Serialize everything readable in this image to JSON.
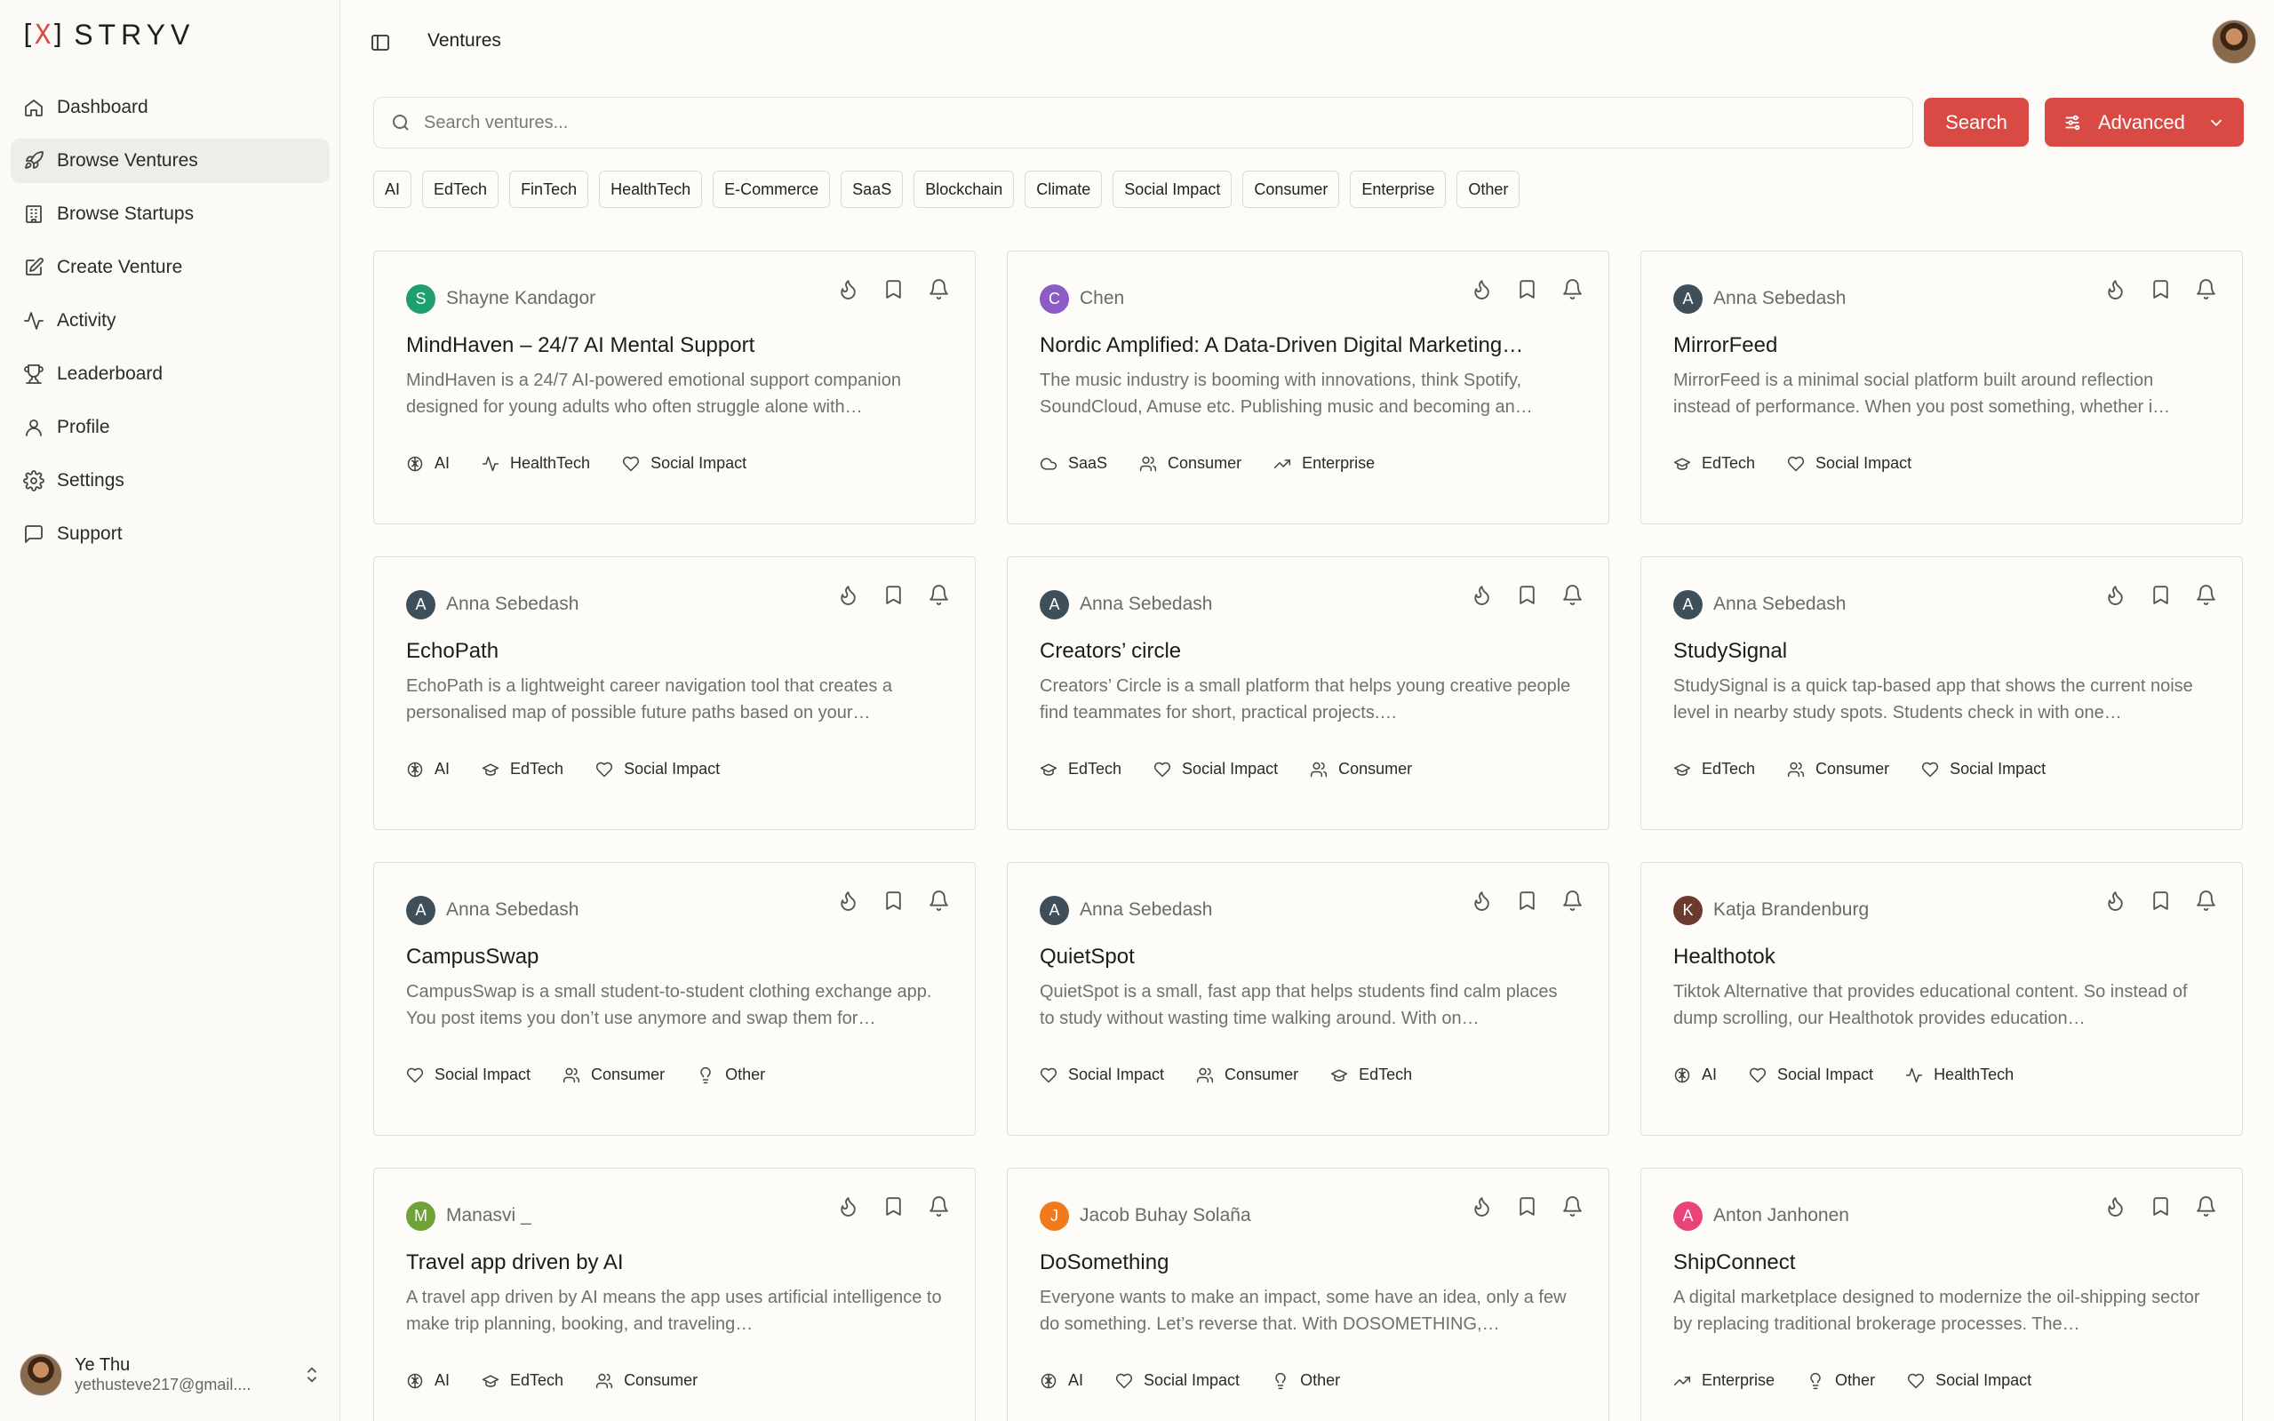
{
  "brand": {
    "name": "STRYV",
    "accent": "#d94a44"
  },
  "sidebar": {
    "items": [
      {
        "label": "Dashboard",
        "icon": "home-icon",
        "active": false
      },
      {
        "label": "Browse Ventures",
        "icon": "rocket-icon",
        "active": true
      },
      {
        "label": "Browse Startups",
        "icon": "building-icon",
        "active": false
      },
      {
        "label": "Create Venture",
        "icon": "edit-icon",
        "active": false
      },
      {
        "label": "Activity",
        "icon": "activity-icon",
        "active": false
      },
      {
        "label": "Leaderboard",
        "icon": "trophy-icon",
        "active": false
      },
      {
        "label": "Profile",
        "icon": "user-icon",
        "active": false
      },
      {
        "label": "Settings",
        "icon": "gear-icon",
        "active": false
      },
      {
        "label": "Support",
        "icon": "message-icon",
        "active": false
      }
    ],
    "user": {
      "name": "Ye Thu",
      "email": "yethusteve217@gmail...."
    }
  },
  "header": {
    "breadcrumb": "Ventures"
  },
  "search": {
    "placeholder": "Search ventures...",
    "button_label": "Search",
    "advanced_label": "Advanced"
  },
  "filters": [
    "AI",
    "EdTech",
    "FinTech",
    "HealthTech",
    "E-Commerce",
    "SaaS",
    "Blockchain",
    "Climate",
    "Social Impact",
    "Consumer",
    "Enterprise",
    "Other"
  ],
  "ventures": [
    {
      "initial": "S",
      "color": "#1f9e6e",
      "author": "Shayne Kandagor",
      "title": "MindHaven – 24/7 AI Mental Support",
      "desc": "MindHaven is a 24/7 AI-powered emotional support companion designed for young adults who often struggle alone with…",
      "tags": [
        [
          "AI",
          "brain-icon"
        ],
        [
          "HealthTech",
          "activity-icon"
        ],
        [
          "Social Impact",
          "heart-icon"
        ]
      ]
    },
    {
      "initial": "C",
      "color": "#8b5cc4",
      "author": "Chen",
      "title": "Nordic Amplified: A Data-Driven Digital Marketing…",
      "desc": "The music industry is booming with innovations, think Spotify, SoundCloud, Amuse etc. Publishing music and becoming an…",
      "tags": [
        [
          "SaaS",
          "cloud-icon"
        ],
        [
          "Consumer",
          "users-icon"
        ],
        [
          "Enterprise",
          "trending-up-icon"
        ]
      ]
    },
    {
      "initial": "A",
      "color": "#3f4f5a",
      "author": "Anna Sebedash",
      "title": "MirrorFeed",
      "desc": "MirrorFeed is a minimal social platform built around reflection instead of performance. When you post something, whether i…",
      "tags": [
        [
          "EdTech",
          "graduation-cap-icon"
        ],
        [
          "Social Impact",
          "heart-icon"
        ]
      ]
    },
    {
      "initial": "A",
      "color": "#3f4f5a",
      "author": "Anna Sebedash",
      "title": "EchoPath",
      "desc": "EchoPath is a lightweight career navigation tool that creates a personalised map of possible future paths based on your…",
      "tags": [
        [
          "AI",
          "brain-icon"
        ],
        [
          "EdTech",
          "graduation-cap-icon"
        ],
        [
          "Social Impact",
          "heart-icon"
        ]
      ]
    },
    {
      "initial": "A",
      "color": "#3f4f5a",
      "author": "Anna Sebedash",
      "title": "Creators’ circle",
      "desc": "Creators’ Circle is a small platform that helps young creative people find teammates for short, practical projects.…",
      "tags": [
        [
          "EdTech",
          "graduation-cap-icon"
        ],
        [
          "Social Impact",
          "heart-icon"
        ],
        [
          "Consumer",
          "users-icon"
        ]
      ]
    },
    {
      "initial": "A",
      "color": "#3f4f5a",
      "author": "Anna Sebedash",
      "title": "StudySignal",
      "desc": "StudySignal is a quick tap-based app that shows the current noise level in nearby study spots. Students check in with one…",
      "tags": [
        [
          "EdTech",
          "graduation-cap-icon"
        ],
        [
          "Consumer",
          "users-icon"
        ],
        [
          "Social Impact",
          "heart-icon"
        ]
      ]
    },
    {
      "initial": "A",
      "color": "#3f4f5a",
      "author": "Anna Sebedash",
      "title": "CampusSwap",
      "desc": "CampusSwap is a small student-to-student clothing exchange app. You post items you don’t use anymore and swap them for…",
      "tags": [
        [
          "Social Impact",
          "heart-icon"
        ],
        [
          "Consumer",
          "users-icon"
        ],
        [
          "Other",
          "lightbulb-icon"
        ]
      ]
    },
    {
      "initial": "A",
      "color": "#3f4f5a",
      "author": "Anna Sebedash",
      "title": "QuietSpot",
      "desc": "QuietSpot is a small, fast app that helps students find calm places to study without wasting time walking around. With on…",
      "tags": [
        [
          "Social Impact",
          "heart-icon"
        ],
        [
          "Consumer",
          "users-icon"
        ],
        [
          "EdTech",
          "graduation-cap-icon"
        ]
      ]
    },
    {
      "initial": "K",
      "color": "#6b3a2e",
      "author": "Katja Brandenburg",
      "title": "Healthotok",
      "desc": "Tiktok Alternative that provides educational content. So instead of dump scrolling, our Healthotok provides education…",
      "tags": [
        [
          "AI",
          "brain-icon"
        ],
        [
          "Social Impact",
          "heart-icon"
        ],
        [
          "HealthTech",
          "activity-icon"
        ]
      ]
    },
    {
      "initial": "M",
      "color": "#6fa33a",
      "author": "Manasvi _",
      "title": "Travel app driven by AI",
      "desc": "A travel app driven by AI means the app uses artificial intelligence to make trip planning, booking, and traveling…",
      "tags": [
        [
          "AI",
          "brain-icon"
        ],
        [
          "EdTech",
          "graduation-cap-icon"
        ],
        [
          "Consumer",
          "users-icon"
        ]
      ]
    },
    {
      "initial": "J",
      "color": "#f07a1c",
      "author": "Jacob Buhay Solaña",
      "title": "DoSomething",
      "desc": "Everyone wants to make an impact, some have an idea, only a few do something. Let’s reverse that. With DOSOMETHING,…",
      "tags": [
        [
          "AI",
          "brain-icon"
        ],
        [
          "Social Impact",
          "heart-icon"
        ],
        [
          "Other",
          "lightbulb-icon"
        ]
      ]
    },
    {
      "initial": "A",
      "color": "#e8447a",
      "author": "Anton Janhonen",
      "title": "ShipConnect",
      "desc": "A digital marketplace designed to modernize the oil-shipping sector by replacing traditional brokerage processes. The…",
      "tags": [
        [
          "Enterprise",
          "trending-up-icon"
        ],
        [
          "Other",
          "lightbulb-icon"
        ],
        [
          "Social Impact",
          "heart-icon"
        ]
      ]
    }
  ]
}
